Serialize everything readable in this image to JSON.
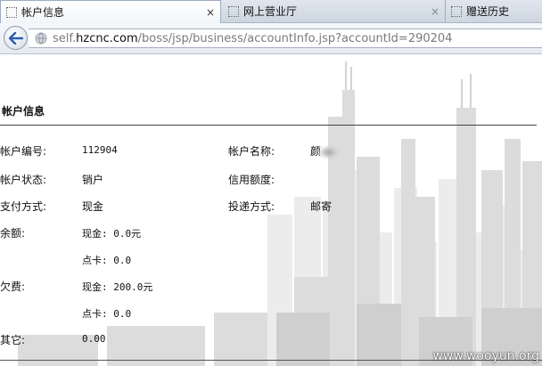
{
  "tabs": [
    {
      "label": "帐户信息",
      "active": true,
      "close": "×"
    },
    {
      "label": "网上营业厅",
      "active": false,
      "close": "×"
    },
    {
      "label": "赠送历史",
      "active": false,
      "close": ""
    }
  ],
  "address": {
    "prefix": "self.",
    "domain": "hzcnc.com",
    "path": "/boss/jsp/business/accountInfo.jsp?accountId=290204"
  },
  "icons": {
    "back": "back-arrow-icon",
    "site": "globe-icon"
  },
  "section": {
    "title": "帐户信息"
  },
  "fields": {
    "account_no_label": "帐户编号:",
    "account_no_value": "112904",
    "account_name_label": "帐户名称:",
    "account_name_value": "颜",
    "status_label": "帐户状态:",
    "status_value": "销户",
    "credit_label": "信用额度:",
    "payment_label": "支付方式:",
    "payment_value": "现金",
    "delivery_label": "投递方式:",
    "delivery_value": "邮寄",
    "balance_label": "余额:",
    "balance_cash": "现金: 0.0元",
    "balance_card": "点卡: 0.0",
    "arrears_label": "欠费:",
    "arrears_cash": "现金: 200.0元",
    "arrears_card": "点卡: 0.0",
    "other_label": "其它:",
    "other_value": "0.00"
  },
  "watermark": "www.wooyun.org",
  "colors": {
    "link_blue": "#2a5db0",
    "rule": "#444444"
  }
}
